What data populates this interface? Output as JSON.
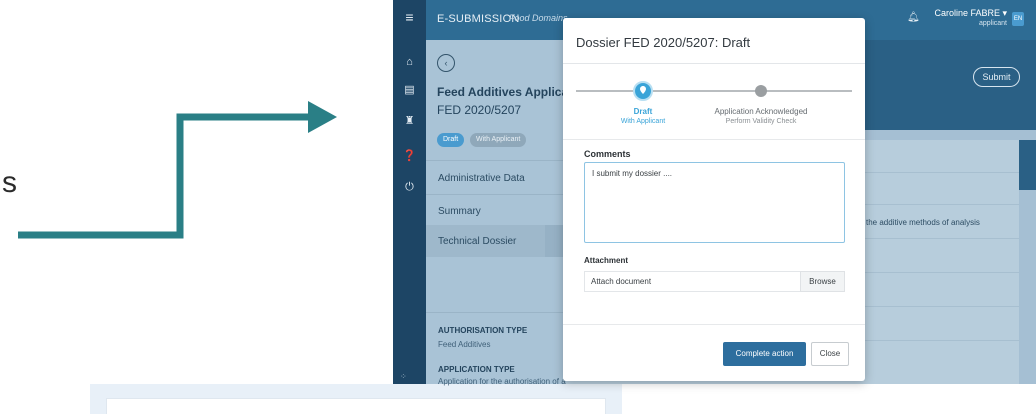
{
  "annotation": {
    "letter": "s"
  },
  "app": {
    "brand": "E-SUBMISSION",
    "brand_sub": "Food Domains",
    "user": {
      "name": "Caroline FABRE ▾",
      "role": "applicant"
    },
    "lang": "EN",
    "left_panel": {
      "title": "Feed Additives Application",
      "id": "FED 2020/5207",
      "badges": [
        "Draft",
        "With Applicant"
      ],
      "items": [
        "Administrative Data",
        "Summary",
        "Technical Dossier"
      ],
      "auth_type_label": "AUTHORISATION TYPE",
      "auth_type_value": "Feed Additives",
      "app_type_label": "APPLICATION TYPE",
      "app_type_value": "Application for the authorisation of a new"
    },
    "header": {
      "submit": "Submit"
    },
    "content": {
      "methods_text": "the additive methods of analysis"
    }
  },
  "modal": {
    "title": "Dossier FED 2020/5207: Draft",
    "steps": [
      {
        "label": "Draft",
        "sub": "With Applicant"
      },
      {
        "label": "Application Acknowledged",
        "sub": "Perform Validity Check"
      }
    ],
    "comments_label": "Comments",
    "comments_value": "I submit my dossier ....",
    "attachment_label": "Attachment",
    "attachment_placeholder": "Attach document",
    "browse": "Browse",
    "complete": "Complete action",
    "close": "Close"
  },
  "colors": {
    "accent": "#3aa4d8",
    "primary_button": "#2d6e9e",
    "sidebar": "#1d4565",
    "arrow": "#2a7f86"
  }
}
